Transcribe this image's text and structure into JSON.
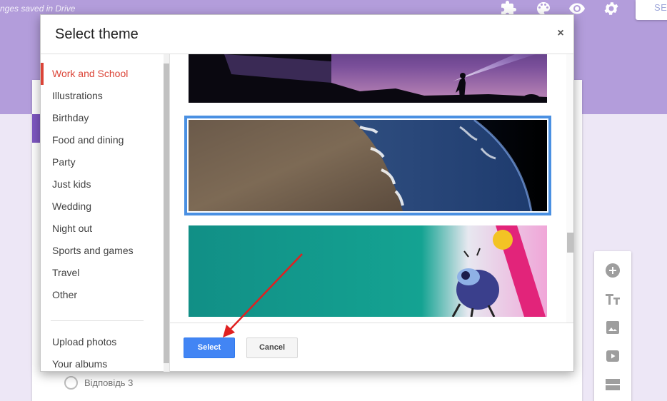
{
  "app": {
    "saved_status": "nges saved in Drive",
    "send_label": "SE",
    "toolbar_icons": [
      "puzzle-icon",
      "palette-icon",
      "eye-icon",
      "gear-icon"
    ],
    "accent_color": "#b39ddb"
  },
  "form": {
    "option_label": "Відповідь 3"
  },
  "side_tools": [
    "add-question-icon",
    "title-text-icon",
    "image-icon",
    "video-icon",
    "section-icon"
  ],
  "dialog": {
    "title": "Select theme",
    "close_label": "×",
    "categories": [
      {
        "label": "Work and School",
        "active": true
      },
      {
        "label": "Illustrations"
      },
      {
        "label": "Birthday"
      },
      {
        "label": "Food and dining"
      },
      {
        "label": "Party"
      },
      {
        "label": "Just kids"
      },
      {
        "label": "Wedding"
      },
      {
        "label": "Night out"
      },
      {
        "label": "Sports and games"
      },
      {
        "label": "Travel"
      },
      {
        "label": "Other"
      }
    ],
    "extra_links": [
      {
        "label": "Upload photos"
      },
      {
        "label": "Your albums"
      }
    ],
    "themes": [
      {
        "name": "night-sky-flashlight-image",
        "selected": false
      },
      {
        "name": "earth-from-space-image",
        "selected": true
      },
      {
        "name": "teal-insect-image",
        "selected": false
      }
    ],
    "select_label": "Select",
    "cancel_label": "Cancel",
    "selected_color": "#4a90e2",
    "active_color": "#db4437"
  }
}
